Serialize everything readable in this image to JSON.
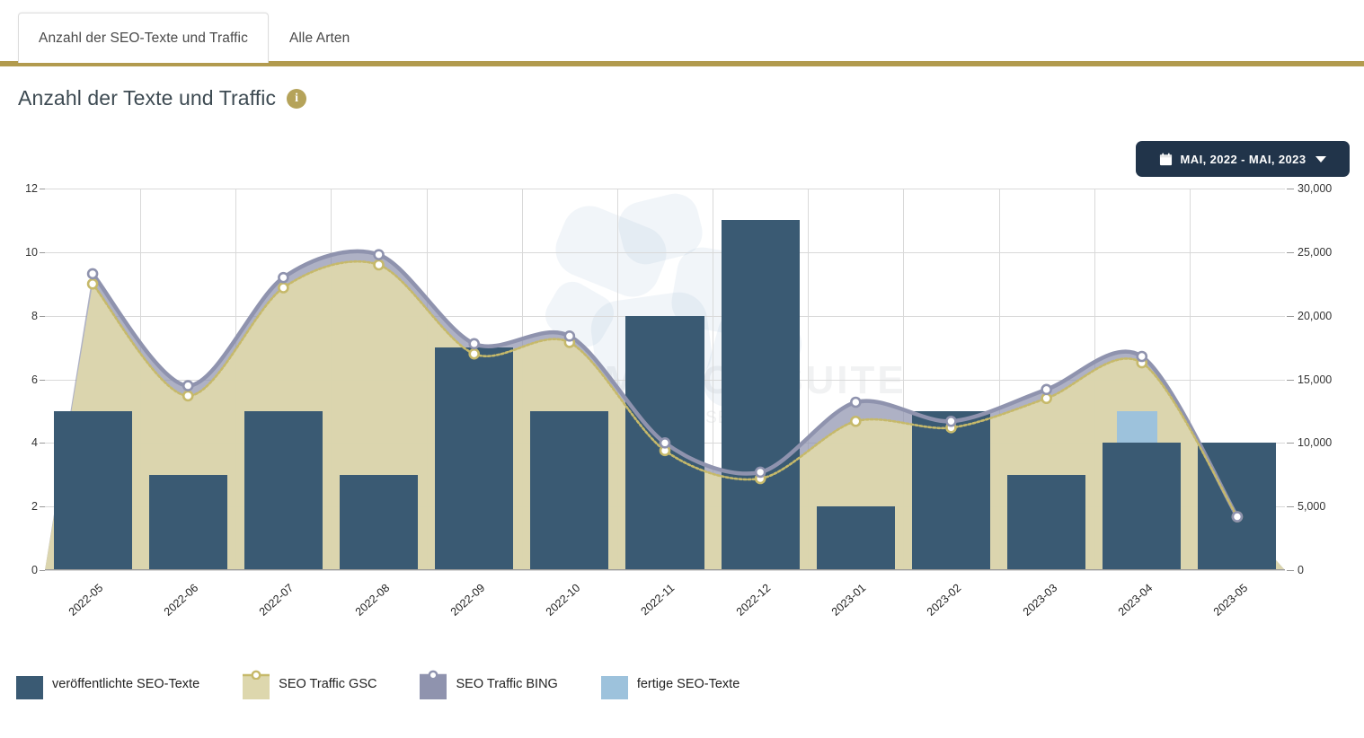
{
  "tabs": [
    {
      "label": "Anzahl der SEO-Texte und Traffic",
      "active": true
    },
    {
      "label": "Alle Arten",
      "active": false
    }
  ],
  "header": {
    "title": "Anzahl der Texte und Traffic",
    "info_icon": "info-icon",
    "info_glyph": "i"
  },
  "date_picker": {
    "label": "MAI, 2022 - MAI, 2023",
    "calendar_icon": "calendar-icon",
    "chevron_icon": "chevron-down-icon"
  },
  "watermark": {
    "main": "PERFORMANCE SUITE",
    "sub": "The Future of SEO"
  },
  "colors": {
    "accent_gold": "#b29b4e",
    "published_bar": "#3a5a73",
    "finished_bar": "#9dc2dc",
    "gsc_area": "#ddd7ad",
    "gsc_line": "#c6b96a",
    "bing_line": "#8f93ae",
    "date_button_bg": "#21344a",
    "grid": "#d9d9d9"
  },
  "chart_data": {
    "type": "bar",
    "title": "Anzahl der Texte und Traffic",
    "xlabel": "",
    "ylabel": "",
    "categories": [
      "2022-05",
      "2022-06",
      "2022-07",
      "2022-08",
      "2022-09",
      "2022-10",
      "2022-11",
      "2022-12",
      "2023-01",
      "2023-02",
      "2023-03",
      "2023-04",
      "2023-05"
    ],
    "left_axis": {
      "ticks": [
        0,
        2,
        4,
        6,
        8,
        10,
        12
      ],
      "ylim": [
        0,
        12
      ],
      "label": ""
    },
    "right_axis": {
      "ticks": [
        "0",
        "5,000",
        "10,000",
        "15,000",
        "20,000",
        "25,000",
        "30,000"
      ],
      "tick_values": [
        0,
        5000,
        10000,
        15000,
        20000,
        25000,
        30000
      ],
      "ylim": [
        0,
        30000
      ],
      "label": ""
    },
    "grid": true,
    "legend_position": "bottom-left",
    "series": [
      {
        "name": "veröffentlichte SEO-Texte",
        "type": "bar",
        "axis": "left",
        "color": "#3a5a73",
        "values": [
          5,
          3,
          5,
          3,
          7,
          5,
          8,
          11,
          2,
          5,
          3,
          4,
          4
        ]
      },
      {
        "name": "SEO Traffic GSC",
        "type": "area",
        "axis": "right",
        "color": "#ddd7ad",
        "line_color": "#c6b96a",
        "values": [
          22500,
          13700,
          22200,
          24000,
          17000,
          17900,
          9400,
          7200,
          11700,
          11200,
          13500,
          16300,
          4200
        ]
      },
      {
        "name": "SEO Traffic BING",
        "type": "area",
        "axis": "right",
        "color": "#8f93ae",
        "line_color": "#8f93ae",
        "values": [
          23300,
          14500,
          23000,
          24800,
          17800,
          18400,
          10000,
          7700,
          13200,
          11700,
          14200,
          16800,
          4200
        ]
      },
      {
        "name": "fertige SEO-Texte",
        "type": "bar",
        "axis": "left",
        "color": "#9dc2dc",
        "values": [
          0,
          0,
          0,
          0,
          0,
          0,
          0,
          0,
          0,
          0,
          0,
          1,
          0
        ],
        "stacked_on": "veröffentlichte SEO-Texte"
      }
    ]
  },
  "legend": [
    {
      "label": "veröffentlichte SEO-Texte",
      "color": "#3a5a73",
      "marker": false
    },
    {
      "label": "SEO Traffic GSC",
      "color": "#ddd7ad",
      "marker": true,
      "marker_color": "#c6b96a"
    },
    {
      "label": "SEO Traffic BING",
      "color": "#8f93ae",
      "marker": true,
      "marker_color": "#8f93ae"
    },
    {
      "label": "fertige SEO-Texte",
      "color": "#9dc2dc",
      "marker": false
    }
  ]
}
